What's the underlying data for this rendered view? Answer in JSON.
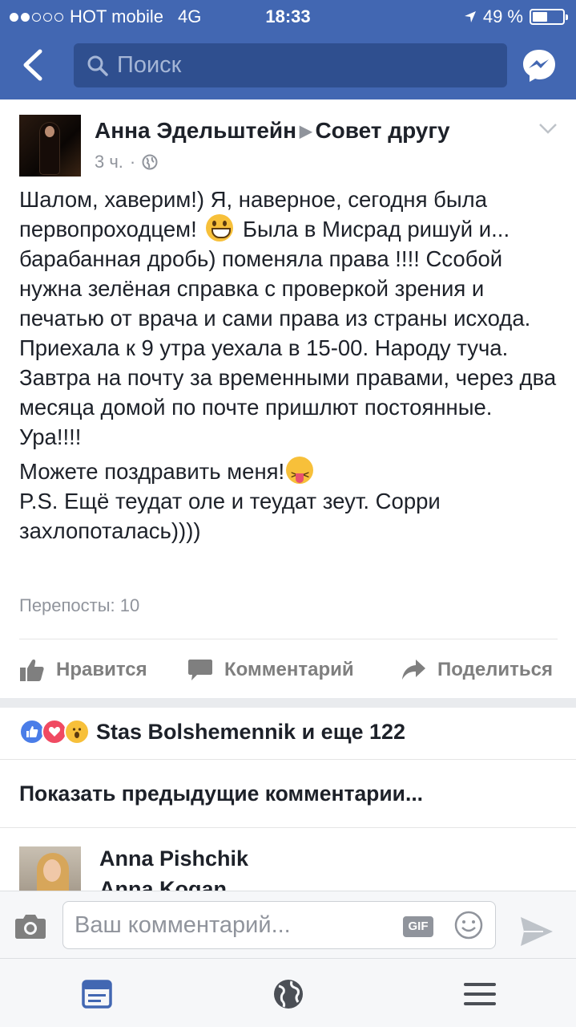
{
  "status_bar": {
    "signal_filled": 2,
    "signal_total": 5,
    "carrier": "HOT mobile",
    "network": "4G",
    "time": "18:33",
    "battery": "49 %",
    "battery_level": 0.49
  },
  "nav": {
    "search_placeholder": "Поиск",
    "icons": [
      "chevron-left-icon",
      "search-icon",
      "messenger-icon"
    ]
  },
  "post": {
    "author": "Анна Эдельштейн",
    "group": "Совет другу",
    "time": "3 ч.",
    "paragraphs": {
      "p1_a": "Шалом, хаверим!) Я, наверное, сегодня была первопроходцем!",
      "p1_b": "Была в Мисрад ришуй и... барабанная дробь) поменяла права !!!! Ссобой нужна зелёная справка с проверкой зрения и печатью от врача и сами права из страны исхода. Приехала к 9 утра уехала в 15-00. Народу туча. Завтра на почту за временными правами, через два месяца домой по почте пришлют постоянные. Ура!!!!",
      "p2_a": "Можете поздравить меня!",
      "p2_b": "P.S. Ещё теудат оле и теудат зеут. Сорри захлопоталась))))"
    },
    "reposts": "Перепосты: 10"
  },
  "actions": {
    "like": "Нравится",
    "comment": "Комментарий",
    "share": "Поделиться"
  },
  "reactions": {
    "text": "Stas Bolshemennik и еще 122"
  },
  "comments": {
    "show_previous": "Показать предыдущие комментарии...",
    "first": {
      "name": "Anna Pishchik",
      "text": "Anna Kogan"
    }
  },
  "composer": {
    "placeholder": "Ваш комментарий...",
    "gif_label": "GIF"
  },
  "tabbar": {
    "icons": [
      "news-feed-icon",
      "globe-icon",
      "menu-icon"
    ]
  },
  "colors": {
    "brand": "#4267b2",
    "search_bg": "#2f4f8f",
    "secondary_text": "#90949c",
    "divider": "#e9ebee"
  }
}
